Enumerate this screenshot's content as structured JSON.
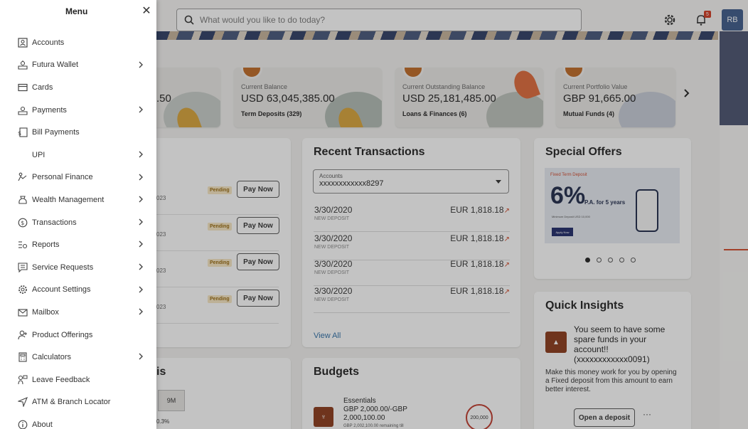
{
  "topbar": {
    "search_placeholder": "What would you like to do today?",
    "notification_count": "5",
    "avatar_initials": "RB"
  },
  "balance_cards": [
    {
      "label": "",
      "amount": ".50",
      "sub": ""
    },
    {
      "label": "Current Balance",
      "amount": "USD 63,045,385.00",
      "sub": "Term Deposits (329)"
    },
    {
      "label": "Current Outstanding Balance",
      "amount": "USD 25,181,485.00",
      "sub": "Loans & Finances (6)"
    },
    {
      "label": "Current Portfolio Value",
      "amount": "GBP 91,665.00",
      "sub": "Mutual Funds (4)"
    }
  ],
  "upcoming": {
    "rows": [
      {
        "date": "023",
        "status": "Pending",
        "action": "Pay Now"
      },
      {
        "date": "023",
        "status": "Pending",
        "action": "Pay Now"
      },
      {
        "date": "023",
        "status": "Pending",
        "action": "Pay Now"
      },
      {
        "date": "023",
        "status": "Pending",
        "action": "Pay Now"
      }
    ]
  },
  "recent_transactions": {
    "title": "Recent Transactions",
    "account_label": "Accounts",
    "account_value": "xxxxxxxxxxxx8297",
    "rows": [
      {
        "date": "3/30/2020",
        "type": "NEW DEPOSIT",
        "amount": "EUR 1,818.18"
      },
      {
        "date": "3/30/2020",
        "type": "NEW DEPOSIT",
        "amount": "EUR 1,818.18"
      },
      {
        "date": "3/30/2020",
        "type": "NEW DEPOSIT",
        "amount": "EUR 1,818.18"
      },
      {
        "date": "3/30/2020",
        "type": "NEW DEPOSIT",
        "amount": "EUR 1,818.18"
      }
    ],
    "view_all": "View All"
  },
  "special_offers": {
    "title": "Special Offers",
    "offer_heading": "Fixed Term Deposit",
    "offer_rate": "6%",
    "offer_pa": "P.A. for 5 years",
    "offer_min": "Minimum Deposit USD 10,000",
    "offer_apply": "Apply Now"
  },
  "quick_insights": {
    "title": "Quick Insights",
    "headline": "You seem to have some spare funds in your account!! (xxxxxxxxxxxx0091)",
    "body": "Make this money work for you by opening a Fixed deposit from this amount to earn better interest.",
    "button": "Open a deposit",
    "more": "···"
  },
  "budgets": {
    "title": "Budgets",
    "name": "Essentials",
    "amount_line1": "GBP 2,000.00/-GBP",
    "amount_line2": "2,000,100.00",
    "remaining": "GBP 2,002,100.00 remaining till",
    "ring_value": "200,000"
  },
  "analysis": {
    "title_fragment": "is",
    "period": "9M",
    "pct": "0.3%"
  },
  "menu": {
    "title": "Menu",
    "items": [
      {
        "label": "Accounts",
        "icon": "accounts-icon",
        "chevron": false
      },
      {
        "label": "Futura Wallet",
        "icon": "wallet-icon",
        "chevron": true
      },
      {
        "label": "Cards",
        "icon": "card-icon",
        "chevron": false
      },
      {
        "label": "Payments",
        "icon": "payments-icon",
        "chevron": true
      },
      {
        "label": "Bill Payments",
        "icon": "bill-icon",
        "chevron": false
      },
      {
        "label": "UPI",
        "icon": "",
        "chevron": true
      },
      {
        "label": "Personal Finance",
        "icon": "personal-finance-icon",
        "chevron": true
      },
      {
        "label": "Wealth Management",
        "icon": "wealth-icon",
        "chevron": true
      },
      {
        "label": "Transactions",
        "icon": "transactions-icon",
        "chevron": true
      },
      {
        "label": "Reports",
        "icon": "reports-icon",
        "chevron": true
      },
      {
        "label": "Service Requests",
        "icon": "service-request-icon",
        "chevron": true
      },
      {
        "label": "Account Settings",
        "icon": "settings-icon",
        "chevron": true
      },
      {
        "label": "Mailbox",
        "icon": "mail-icon",
        "chevron": true
      },
      {
        "label": "Product Offerings",
        "icon": "product-offerings-icon",
        "chevron": false
      },
      {
        "label": "Calculators",
        "icon": "calculator-icon",
        "chevron": true
      },
      {
        "label": "Leave Feedback",
        "icon": "feedback-icon",
        "chevron": false
      },
      {
        "label": "ATM & Branch Locator",
        "icon": "location-icon",
        "chevron": false
      },
      {
        "label": "About",
        "icon": "info-icon",
        "chevron": false
      }
    ]
  },
  "colors": {
    "accent": "#c06a25",
    "link": "#2f6fa7",
    "brand_dark": "#1f2a4a"
  }
}
